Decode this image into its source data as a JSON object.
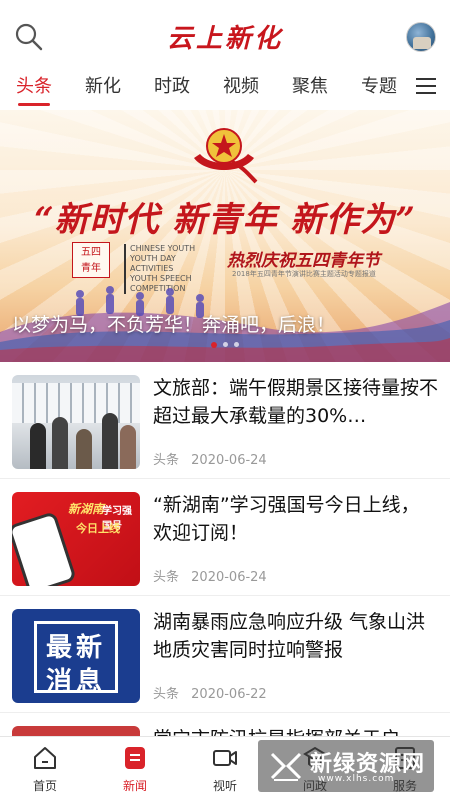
{
  "header": {
    "title": "云上新化"
  },
  "tabs": [
    "头条",
    "新化",
    "时政",
    "视频",
    "聚焦",
    "专题"
  ],
  "banner": {
    "slogan": "“新时代 新青年 新作为”",
    "badge_line1": "五四",
    "badge_line2": "青年",
    "en_line1": "CHINESE YOUTH",
    "en_line2": "YOUTH DAY ACTIVITIES",
    "en_line3": "YOUTH SPEECH COMPETITION",
    "event": "热烈庆祝五四青年节",
    "event_sub": "2018年五四青年节演讲比赛主题活动专题报道",
    "caption": "以梦为马，不负芳华！奔涌吧，后浪！",
    "page_count": 3,
    "active_page": 1
  },
  "news": [
    {
      "title": "文旅部：端午假期景区接待量按不超过最大承载量的30%…",
      "source": "头条",
      "date": "2020-06-24"
    },
    {
      "title": "“新湖南”学习强国号今日上线，欢迎订阅！",
      "source": "头条",
      "date": "2020-06-24",
      "thumb_title": "新湖南",
      "thumb_sub": "学习强国号",
      "thumb_today": "今日上线"
    },
    {
      "title": "湖南暴雨应急响应升级 气象山洪地质灾害同时拉响警报",
      "source": "头条",
      "date": "2020-06-22",
      "thumb_line1": "最新",
      "thumb_line2": "消息"
    },
    {
      "title": "常宁市防汛抗旱指挥部关于启…",
      "source": "",
      "date": ""
    }
  ],
  "bottom_nav": [
    {
      "label": "首页",
      "icon": "home-icon"
    },
    {
      "label": "新闻",
      "icon": "news-icon"
    },
    {
      "label": "视听",
      "icon": "video-icon"
    },
    {
      "label": "问政",
      "icon": "ask-icon"
    },
    {
      "label": "服务",
      "icon": "service-icon"
    }
  ],
  "watermark": {
    "text": "新绿资源网",
    "url": "www.xlhs.com"
  },
  "colors": {
    "accent": "#d9232a",
    "title_red": "#c8161d"
  }
}
